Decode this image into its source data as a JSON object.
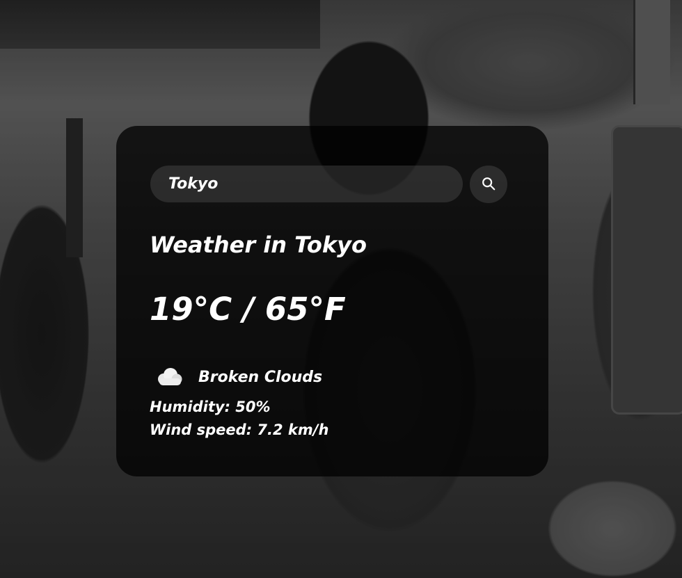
{
  "search": {
    "value": "Tokyo",
    "button_icon": "search-icon"
  },
  "weather": {
    "city_title": "Weather in Tokyo",
    "temperature": "19°C / 65°F",
    "condition_icon": "cloud-icon",
    "condition": "Broken Clouds",
    "humidity": "Humidity: 50%",
    "wind": "Wind speed: 7.2 km/h"
  },
  "colors": {
    "card_background": "#000000",
    "text": "#ffffff",
    "input_background": "#7c7c7c"
  }
}
